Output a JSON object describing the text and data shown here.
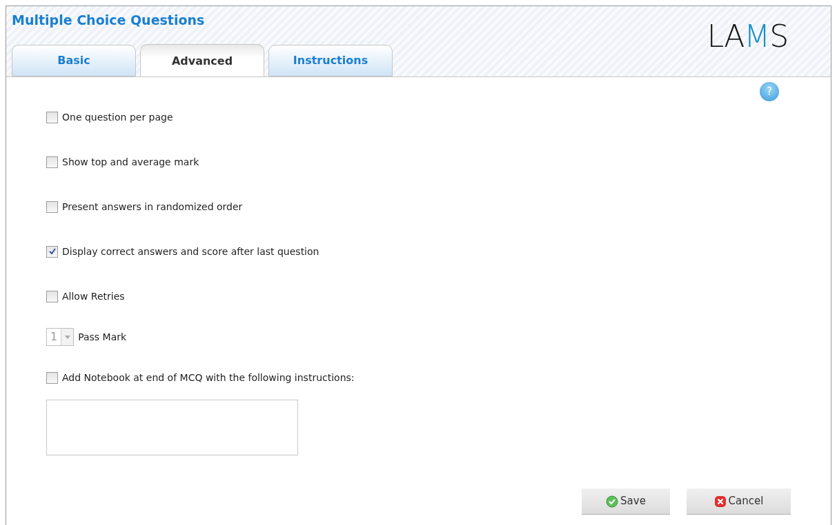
{
  "window": {
    "title": "Multiple Choice Questions",
    "logo": "LAMS"
  },
  "tabs": [
    {
      "label": "Basic",
      "selected": false
    },
    {
      "label": "Advanced",
      "selected": true
    },
    {
      "label": "Instructions",
      "selected": false
    }
  ],
  "options": [
    {
      "kind": "checkbox",
      "label": "One question per page",
      "checked": false
    },
    {
      "kind": "checkbox",
      "label": "Show top and average mark",
      "checked": false
    },
    {
      "kind": "checkbox",
      "label": "Present answers in randomized order",
      "checked": false
    },
    {
      "kind": "checkbox",
      "label": "Display correct answers and score after last question",
      "checked": true
    },
    {
      "kind": "checkbox",
      "label": "Allow Retries",
      "checked": false
    },
    {
      "kind": "select",
      "label": "Pass Mark",
      "value": "1",
      "disabled": true
    },
    {
      "kind": "checkbox",
      "label": "Add Notebook at end of MCQ with the following instructions:",
      "checked": false
    }
  ],
  "help": "?",
  "buttons": [
    {
      "kind": "save",
      "label": "Save"
    },
    {
      "kind": "cancel",
      "label": "Cancel"
    }
  ]
}
